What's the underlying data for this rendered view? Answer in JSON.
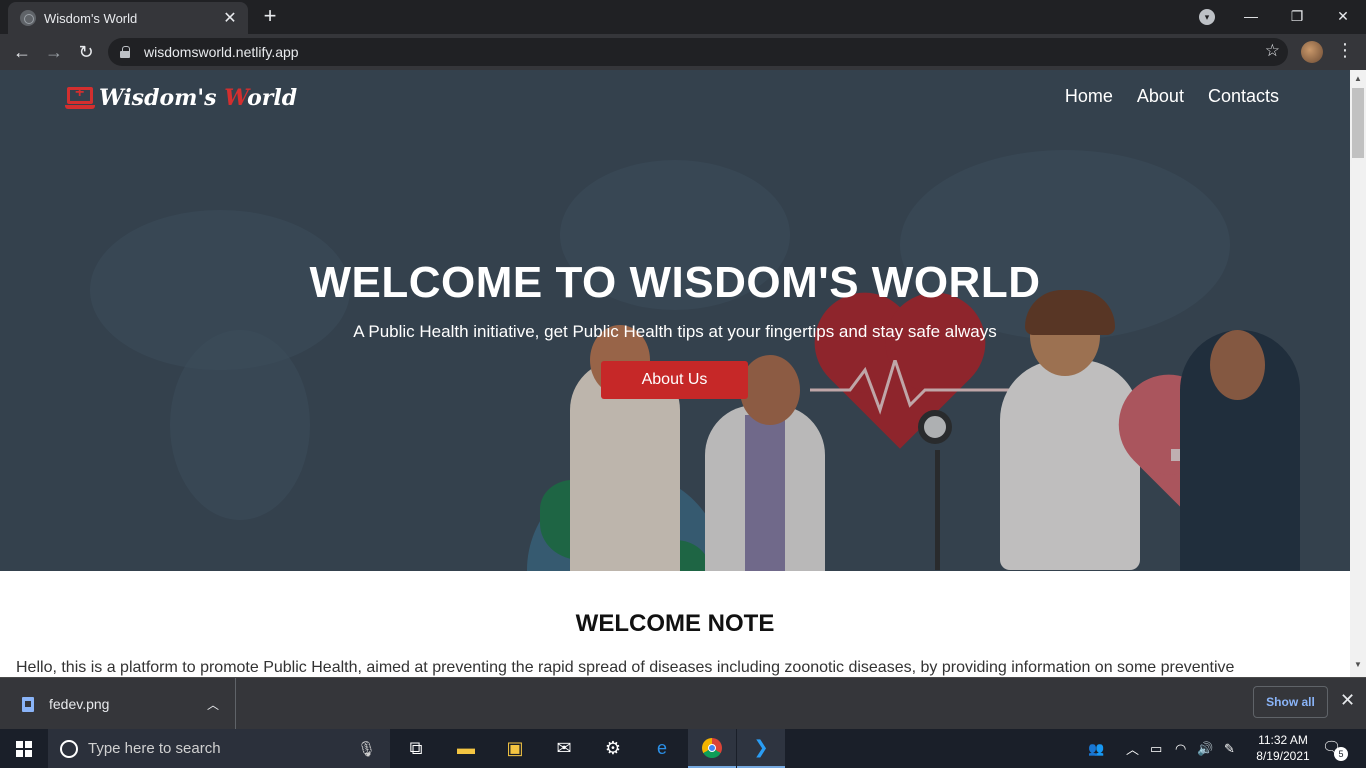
{
  "browser": {
    "tab_title": "Wisdom's World",
    "url": "wisdomsworld.netlify.app",
    "icons": {
      "back": "back-arrow-icon",
      "forward": "forward-arrow-icon",
      "reload": "reload-icon",
      "lock": "lock-icon",
      "star": "bookmark-star-icon",
      "menu": "menu-dots-icon"
    }
  },
  "site": {
    "logo_text_1": "Wisdom's ",
    "logo_text_w": "W",
    "logo_text_2": "orld",
    "nav": [
      "Home",
      "About",
      "Contacts"
    ],
    "hero_title": "WELCOME TO WISDOM'S WORLD",
    "hero_subtitle": "A Public Health initiative, get Public Health tips at your fingertips and stay safe always",
    "hero_button": "About Us",
    "section_title": "WELCOME NOTE",
    "intro_text": "Hello, this is a platform to promote Public Health, aimed at preventing the rapid spread of diseases including zoonotic diseases, by providing information on some preventive",
    "colors": {
      "accent": "#c62828",
      "hero_bg": "#3b4a57"
    }
  },
  "downloads": {
    "file_name": "fedev.png",
    "show_all": "Show all"
  },
  "taskbar": {
    "search_placeholder": "Type here to search",
    "time": "11:32 AM",
    "date": "8/19/2021",
    "notification_count": "5"
  }
}
